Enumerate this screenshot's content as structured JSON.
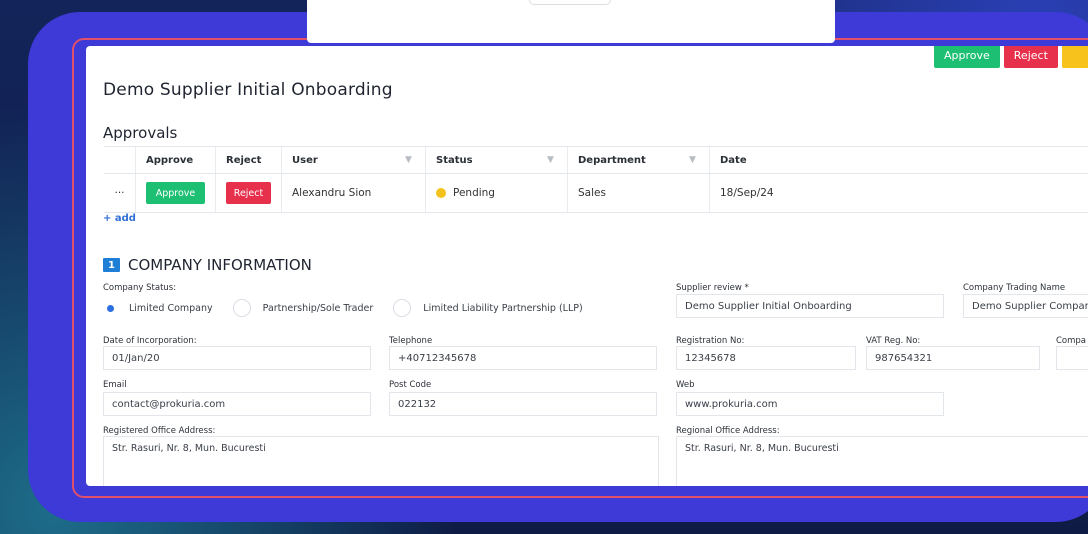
{
  "window": {
    "title": "Demo Supplier Initial Onboarding"
  },
  "toolbar": {
    "approve_label": "Approve",
    "reject_label": "Reject"
  },
  "approvals": {
    "title": "Approvals",
    "columns": [
      "Approve",
      "Reject",
      "User",
      "Status",
      "Department",
      "Date"
    ],
    "rows": [
      {
        "menu": "···",
        "approve": "Approve",
        "reject": "Reject",
        "user": "Alexandru Sion",
        "status": "Pending",
        "department": "Sales",
        "date": "18/Sep/24"
      }
    ],
    "add_label": "+ add"
  },
  "company": {
    "section_number": "1",
    "section_title": "COMPANY INFORMATION",
    "status_label": "Company Status:",
    "status_options": [
      "Limited Company",
      "Partnership/Sole Trader",
      "Limited Liability Partnership (LLP)"
    ],
    "status_selected": "Limited Company",
    "supplier_review_label": "Supplier review *",
    "supplier_review_value": "Demo Supplier Initial Onboarding",
    "trading_name_label": "Company Trading Name",
    "trading_name_value": "Demo Supplier Compar",
    "incorporation_label": "Date of Incorporation:",
    "incorporation_value": "01/Jan/20",
    "telephone_label": "Telephone",
    "telephone_value": "+40712345678",
    "registration_label": "Registration No:",
    "registration_value": "12345678",
    "vat_label": "VAT Reg. No:",
    "vat_value": "987654321",
    "compa_label": "Compa",
    "email_label": "Email",
    "email_value": "contact@prokuria.com",
    "postcode_label": "Post Code",
    "postcode_value": "022132",
    "web_label": "Web",
    "web_value": "www.prokuria.com",
    "registered_address_label": "Registered Office Address:",
    "registered_address_value": "Str. Rasuri, Nr. 8, Mun. Bucuresti",
    "regional_address_label": "Regional Office Address:",
    "regional_address_value": "Str. Rasuri, Nr. 8, Mun. Bucuresti"
  },
  "colors": {
    "approve": "#1dbf73",
    "reject": "#e7304c",
    "pending": "#f4c21c",
    "frame": "#3d3ad8",
    "accent": "#1f7fd6"
  },
  "icons": {
    "filter": "filter-icon",
    "row_menu": "more-icon",
    "status": "status-dot-icon",
    "section": "section-number-badge"
  }
}
